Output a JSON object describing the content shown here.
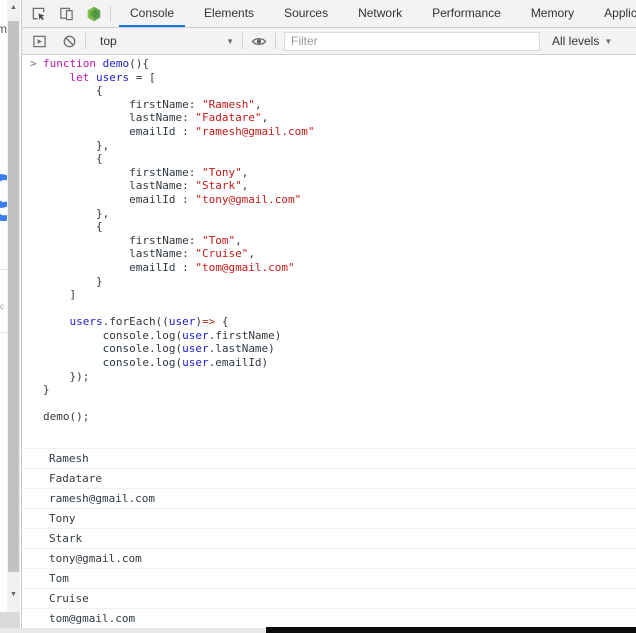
{
  "tabs": {
    "items": [
      "Console",
      "Elements",
      "Sources",
      "Network",
      "Performance",
      "Memory",
      "Application"
    ],
    "active": "Console"
  },
  "toolbar": {
    "context": "top",
    "filter_placeholder": "Filter",
    "levels_label": "All levels",
    "dropdown_arrow": "▼"
  },
  "icons": {
    "scroll_up_arrow": "▲",
    "scroll_down_arrow": "▼"
  },
  "page_sliver": {
    "top_text": "m",
    "big_letter": "g",
    "card_text": "c"
  },
  "console": {
    "prompt_chevron": ">",
    "code_lines": [
      [
        [
          "kw",
          "function"
        ],
        [
          "pl",
          " "
        ],
        [
          "id",
          "demo"
        ],
        [
          "pl",
          "(){"
        ]
      ],
      [
        [
          "pl",
          "    "
        ],
        [
          "kw",
          "let"
        ],
        [
          "pl",
          " "
        ],
        [
          "id",
          "users"
        ],
        [
          "pl",
          " = ["
        ]
      ],
      [
        [
          "pl",
          "        {"
        ]
      ],
      [
        [
          "pl",
          "             firstName: "
        ],
        [
          "str",
          "\"Ramesh\""
        ],
        [
          "pl",
          ","
        ]
      ],
      [
        [
          "pl",
          "             lastName: "
        ],
        [
          "str",
          "\"Fadatare\""
        ],
        [
          "pl",
          ","
        ]
      ],
      [
        [
          "pl",
          "             emailId : "
        ],
        [
          "str",
          "\"ramesh@gmail.com\""
        ]
      ],
      [
        [
          "pl",
          "        },"
        ]
      ],
      [
        [
          "pl",
          "        {"
        ]
      ],
      [
        [
          "pl",
          "             firstName: "
        ],
        [
          "str",
          "\"Tony\""
        ],
        [
          "pl",
          ","
        ]
      ],
      [
        [
          "pl",
          "             lastName: "
        ],
        [
          "str",
          "\"Stark\""
        ],
        [
          "pl",
          ","
        ]
      ],
      [
        [
          "pl",
          "             emailId : "
        ],
        [
          "str",
          "\"tony@gmail.com\""
        ]
      ],
      [
        [
          "pl",
          "        },"
        ]
      ],
      [
        [
          "pl",
          "        {"
        ]
      ],
      [
        [
          "pl",
          "             firstName: "
        ],
        [
          "str",
          "\"Tom\""
        ],
        [
          "pl",
          ","
        ]
      ],
      [
        [
          "pl",
          "             lastName: "
        ],
        [
          "str",
          "\"Cruise\""
        ],
        [
          "pl",
          ","
        ]
      ],
      [
        [
          "pl",
          "             emailId : "
        ],
        [
          "str",
          "\"tom@gmail.com\""
        ]
      ],
      [
        [
          "pl",
          "        }"
        ]
      ],
      [
        [
          "pl",
          "    ]"
        ]
      ],
      [],
      [
        [
          "pl",
          "    "
        ],
        [
          "id",
          "users"
        ],
        [
          "pl",
          ".forEach(("
        ],
        [
          "id",
          "user"
        ],
        [
          "pl",
          ")"
        ],
        [
          "op",
          "=>"
        ],
        [
          "pl",
          " {"
        ]
      ],
      [
        [
          "pl",
          "         console.log("
        ],
        [
          "id",
          "user"
        ],
        [
          "pl",
          ".firstName)"
        ]
      ],
      [
        [
          "pl",
          "         console.log("
        ],
        [
          "id",
          "user"
        ],
        [
          "pl",
          ".lastName)"
        ]
      ],
      [
        [
          "pl",
          "         console.log("
        ],
        [
          "id",
          "user"
        ],
        [
          "pl",
          ".emailId)"
        ]
      ],
      [
        [
          "pl",
          "    });"
        ]
      ],
      [
        [
          "pl",
          "}"
        ]
      ],
      [],
      [
        [
          "pl",
          "demo();"
        ]
      ]
    ],
    "output_lines": [
      "Ramesh",
      "Fadatare",
      "ramesh@gmail.com",
      "Tony",
      "Stark",
      "tony@gmail.com",
      "Tom",
      "Cruise",
      "tom@gmail.com"
    ]
  },
  "colors": {
    "active_tab_underline": "#1a73e8",
    "toolbar_background": "#f3f3f3",
    "keyword": "#c016ae",
    "identifier": "#2222cc",
    "string": "#c41a16",
    "arrow_operator": "#a5341f",
    "text": "#303942",
    "row_divider": "#f0f0f0",
    "extension_icon_green": "#5fa04e",
    "page_blue_letter": "#3b7df0"
  }
}
